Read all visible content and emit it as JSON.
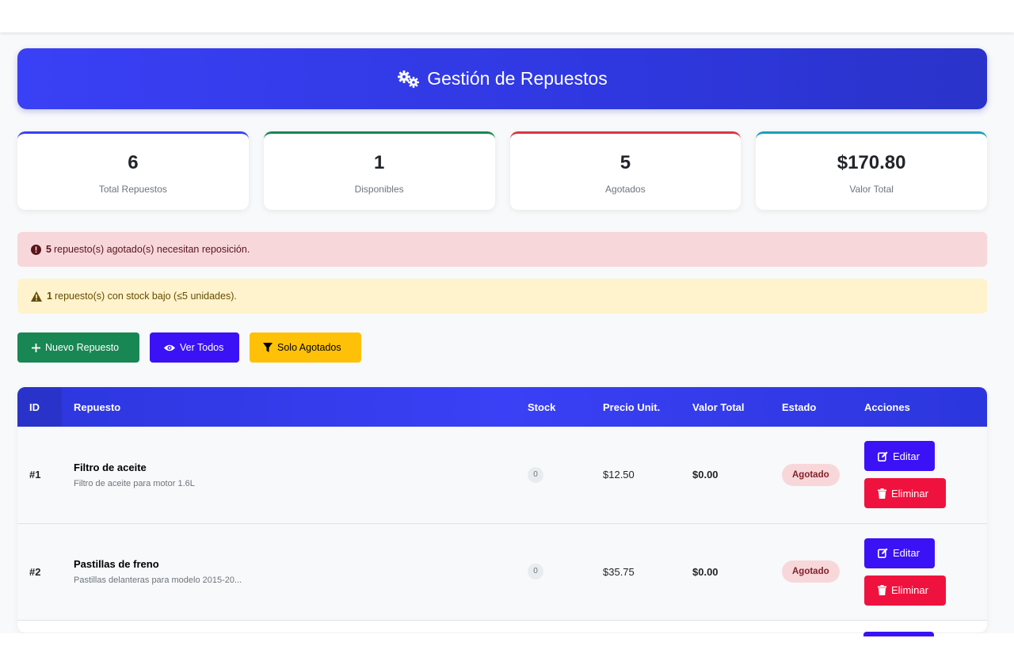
{
  "header": {
    "title": "Gestión de Repuestos",
    "icon": "gears-icon"
  },
  "stats": [
    {
      "value": "6",
      "label": "Total Repuestos",
      "color": "#3a40f5"
    },
    {
      "value": "1",
      "label": "Disponibles",
      "color": "#198754"
    },
    {
      "value": "5",
      "label": "Agotados",
      "color": "#dc3545"
    },
    {
      "value": "$170.80",
      "label": "Valor Total",
      "color": "#17a2b8"
    }
  ],
  "alerts": {
    "danger": {
      "count": "5",
      "text": "repuesto(s) agotado(s) necesitan reposición."
    },
    "warning": {
      "count": "1",
      "text": "repuesto(s) con stock bajo (≤5 unidades)."
    }
  },
  "actions": {
    "new": "Nuevo Repuesto",
    "view_all": "Ver Todos",
    "only_out": "Solo Agotados"
  },
  "table": {
    "headers": [
      "ID",
      "Repuesto",
      "Stock",
      "Precio Unit.",
      "Valor Total",
      "Estado",
      "Acciones"
    ],
    "rows": [
      {
        "id": "#1",
        "name": "Filtro de aceite",
        "desc": "Filtro de aceite para motor 1.6L",
        "stock": "0",
        "price": "$12.50",
        "total": "$0.00",
        "estado": "Agotado",
        "edit": "Editar",
        "delete": "Eliminar"
      },
      {
        "id": "#2",
        "name": "Pastillas de freno",
        "desc": "Pastillas delanteras para modelo 2015-20...",
        "stock": "0",
        "price": "$35.75",
        "total": "$0.00",
        "estado": "Agotado",
        "edit": "Editar",
        "delete": "Eliminar"
      }
    ]
  },
  "colors": {
    "primary": "#3a40f5",
    "success": "#198754",
    "danger": "#dc3545",
    "warning": "#ffc107",
    "purple": "#3b12f5",
    "delete": "#f0123e"
  }
}
